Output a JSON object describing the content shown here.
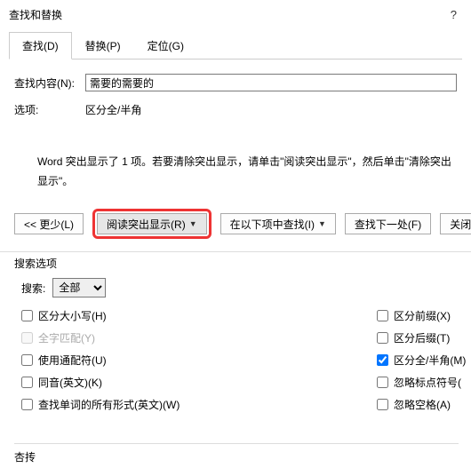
{
  "title": "查找和替换",
  "help": "?",
  "tabs": {
    "find": "查找(D)",
    "replace": "替换(P)",
    "goto": "定位(G)"
  },
  "form": {
    "find_label": "查找内容(N):",
    "find_value": "需要的需要的",
    "opts_label": "选项:",
    "opts_value": "区分全/半角"
  },
  "message": "Word 突出显示了 1 项。若要清除突出显示，请单击\"阅读突出显示\"，然后单击\"清除突出显示\"。",
  "buttons": {
    "less": "<< 更少(L)",
    "highlight": "阅读突出显示(R)",
    "findin": "在以下项中查找(I)",
    "next": "查找下一处(F)",
    "close": "关闭"
  },
  "chev": "▼",
  "search_options_header": "搜索选项",
  "search_label": "搜索:",
  "search_value": "全部",
  "checks": {
    "case": "区分大小写(H)",
    "whole": "全字匹配(Y)",
    "wildcard": "使用通配符(U)",
    "soundslike": "同音(英文)(K)",
    "wordforms": "查找单词的所有形式(英文)(W)",
    "prefix": "区分前缀(X)",
    "suffix": "区分后缀(T)",
    "fullhalf": "区分全/半角(M)",
    "punct": "忽略标点符号(",
    "space": "忽略空格(A)"
  },
  "bottom": "杏抟"
}
